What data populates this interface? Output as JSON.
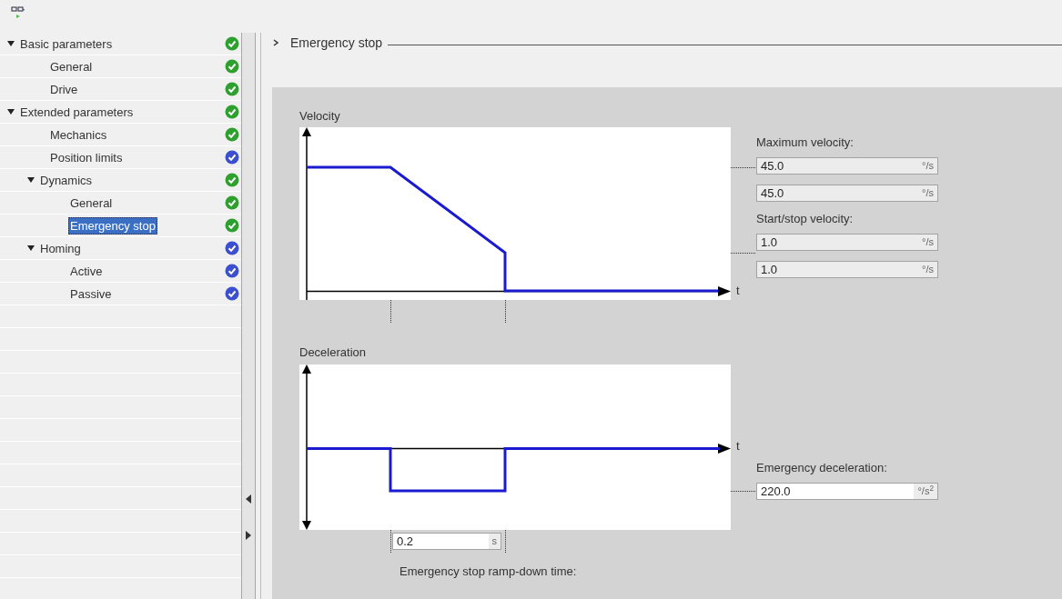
{
  "tree": [
    {
      "label": "Basic parameters",
      "expanded": true,
      "selected": false,
      "color": "#2ea02e",
      "children": [
        {
          "label": "General",
          "selected": false,
          "color": "#2ea02e"
        },
        {
          "label": "Drive",
          "selected": false,
          "color": "#2ea02e"
        }
      ]
    },
    {
      "label": "Extended parameters",
      "expanded": true,
      "selected": false,
      "color": "#2ea02e",
      "children": [
        {
          "label": "Mechanics",
          "selected": false,
          "color": "#2ea02e"
        },
        {
          "label": "Position limits",
          "selected": false,
          "color": "#3b4fd0"
        },
        {
          "label": "Dynamics",
          "expanded": true,
          "selected": false,
          "color": "#2ea02e",
          "children": [
            {
              "label": "General",
              "selected": false,
              "color": "#2ea02e"
            },
            {
              "label": "Emergency stop",
              "selected": true,
              "color": "#2ea02e"
            }
          ]
        },
        {
          "label": "Homing",
          "expanded": true,
          "selected": false,
          "color": "#3b4fd0",
          "children": [
            {
              "label": "Active",
              "selected": false,
              "color": "#3b4fd0"
            },
            {
              "label": "Passive",
              "selected": false,
              "color": "#3b4fd0"
            }
          ]
        }
      ]
    }
  ],
  "section": {
    "title": "Emergency stop",
    "expanded": false
  },
  "velocity": {
    "title": "Velocity",
    "axis_label": "t",
    "params": [
      {
        "kind": "label",
        "text": "Maximum velocity:"
      },
      {
        "kind": "field",
        "value": "45.0",
        "unit": "°/s",
        "editable": false
      },
      {
        "kind": "field",
        "value": "45.0",
        "unit": "°/s",
        "editable": false
      },
      {
        "kind": "label",
        "text": "Start/stop velocity:"
      },
      {
        "kind": "field",
        "value": "1.0",
        "unit": "°/s",
        "editable": false
      },
      {
        "kind": "field",
        "value": "1.0",
        "unit": "°/s",
        "editable": false
      }
    ]
  },
  "deceleration": {
    "title": "Deceleration",
    "axis_label": "t",
    "params": [
      {
        "kind": "label",
        "text": "Emergency deceleration:"
      },
      {
        "kind": "field",
        "value": "220.0",
        "unit": "°/s$^{2}$",
        "editable": true
      }
    ],
    "ramp_field": {
      "value": "0.2",
      "unit": "s",
      "editable": true
    },
    "ramp_label": "Emergency stop ramp-down time:"
  }
}
